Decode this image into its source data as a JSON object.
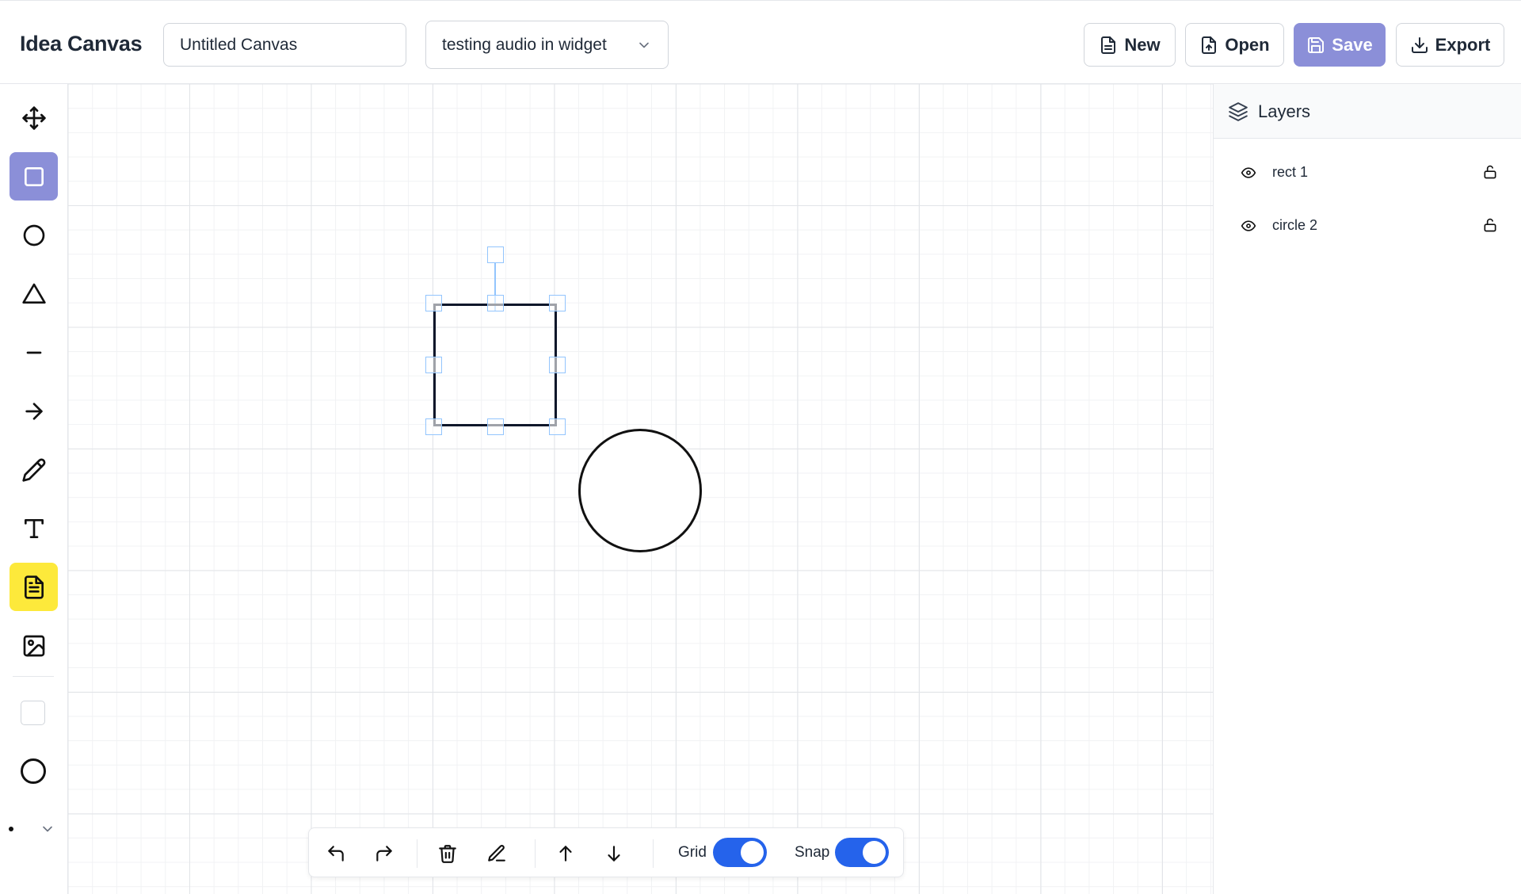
{
  "header": {
    "app_title": "Idea Canvas",
    "canvas_title": "Untitled Canvas",
    "selected_canvas": "testing audio in widget",
    "buttons": {
      "new": "New",
      "open": "Open",
      "save": "Save",
      "export": "Export"
    }
  },
  "toolbar": {
    "tools": [
      "move-icon",
      "rectangle-icon",
      "circle-icon",
      "triangle-icon",
      "line-icon",
      "arrow-icon",
      "pencil-icon",
      "text-icon",
      "note-icon",
      "image-icon"
    ],
    "active_tool": "rectangle",
    "fill_color": "#ffffff",
    "stroke_color": "#111111"
  },
  "canvas": {
    "shapes": [
      {
        "name": "rect 1",
        "type": "rectangle",
        "selected": true
      },
      {
        "name": "circle 2",
        "type": "circle",
        "selected": false
      }
    ]
  },
  "bottom_bar": {
    "grid_label": "Grid",
    "snap_label": "Snap",
    "grid_on": true,
    "snap_on": true
  },
  "layers": {
    "title": "Layers",
    "items": [
      {
        "label": "rect 1",
        "visible": true,
        "locked": false
      },
      {
        "label": "circle 2",
        "visible": true,
        "locked": false
      }
    ]
  },
  "colors": {
    "accent": "#8b8fd8",
    "note_tool": "#fde93b",
    "toggle_on": "#2563eb",
    "selection_handle": "#93c5fd"
  }
}
